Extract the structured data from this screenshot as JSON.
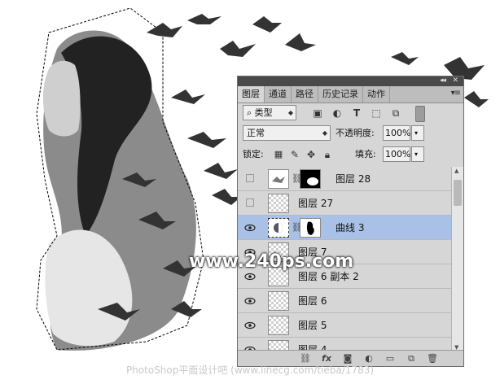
{
  "artwork": {
    "description_icon": "woman-with-seagulls-artwork"
  },
  "panel": {
    "tabs": [
      {
        "label": "图层",
        "active": true
      },
      {
        "label": "通道"
      },
      {
        "label": "路径"
      },
      {
        "label": "历史记录"
      },
      {
        "label": "动作"
      }
    ],
    "menu_icon": "panel-menu-icon",
    "filter": {
      "label": "类型",
      "icons": [
        "image-filter-icon",
        "adjust-filter-icon",
        "type-filter-icon",
        "shape-filter-icon",
        "smart-filter-icon",
        "toggle-filter-icon"
      ]
    },
    "blend_mode": "正常",
    "opacity_label": "不透明度:",
    "opacity_value": "100%",
    "lock_label": "锁定:",
    "fill_label": "填充:",
    "fill_value": "100%",
    "layers": [
      {
        "name": "图层 28",
        "visible": false,
        "has_mask": true,
        "selected": false
      },
      {
        "name": "图层 27",
        "visible": false,
        "has_mask": false,
        "selected": false
      },
      {
        "name": "曲线 3",
        "visible": true,
        "has_mask": true,
        "selected": true,
        "adjustment": true
      },
      {
        "name": "图层 7",
        "visible": true,
        "has_mask": false,
        "selected": false
      },
      {
        "name": "图层 6 副本 2",
        "visible": true,
        "has_mask": false,
        "selected": false
      },
      {
        "name": "图层 6",
        "visible": true,
        "has_mask": false,
        "selected": false
      },
      {
        "name": "图层 5",
        "visible": true,
        "has_mask": false,
        "selected": false
      },
      {
        "name": "图层 4",
        "visible": true,
        "has_mask": false,
        "selected": false
      }
    ]
  },
  "watermark": "www.240ps.com",
  "footer": "PhotoShop平面设计吧 (www.linecg.com/tieba/1783)"
}
